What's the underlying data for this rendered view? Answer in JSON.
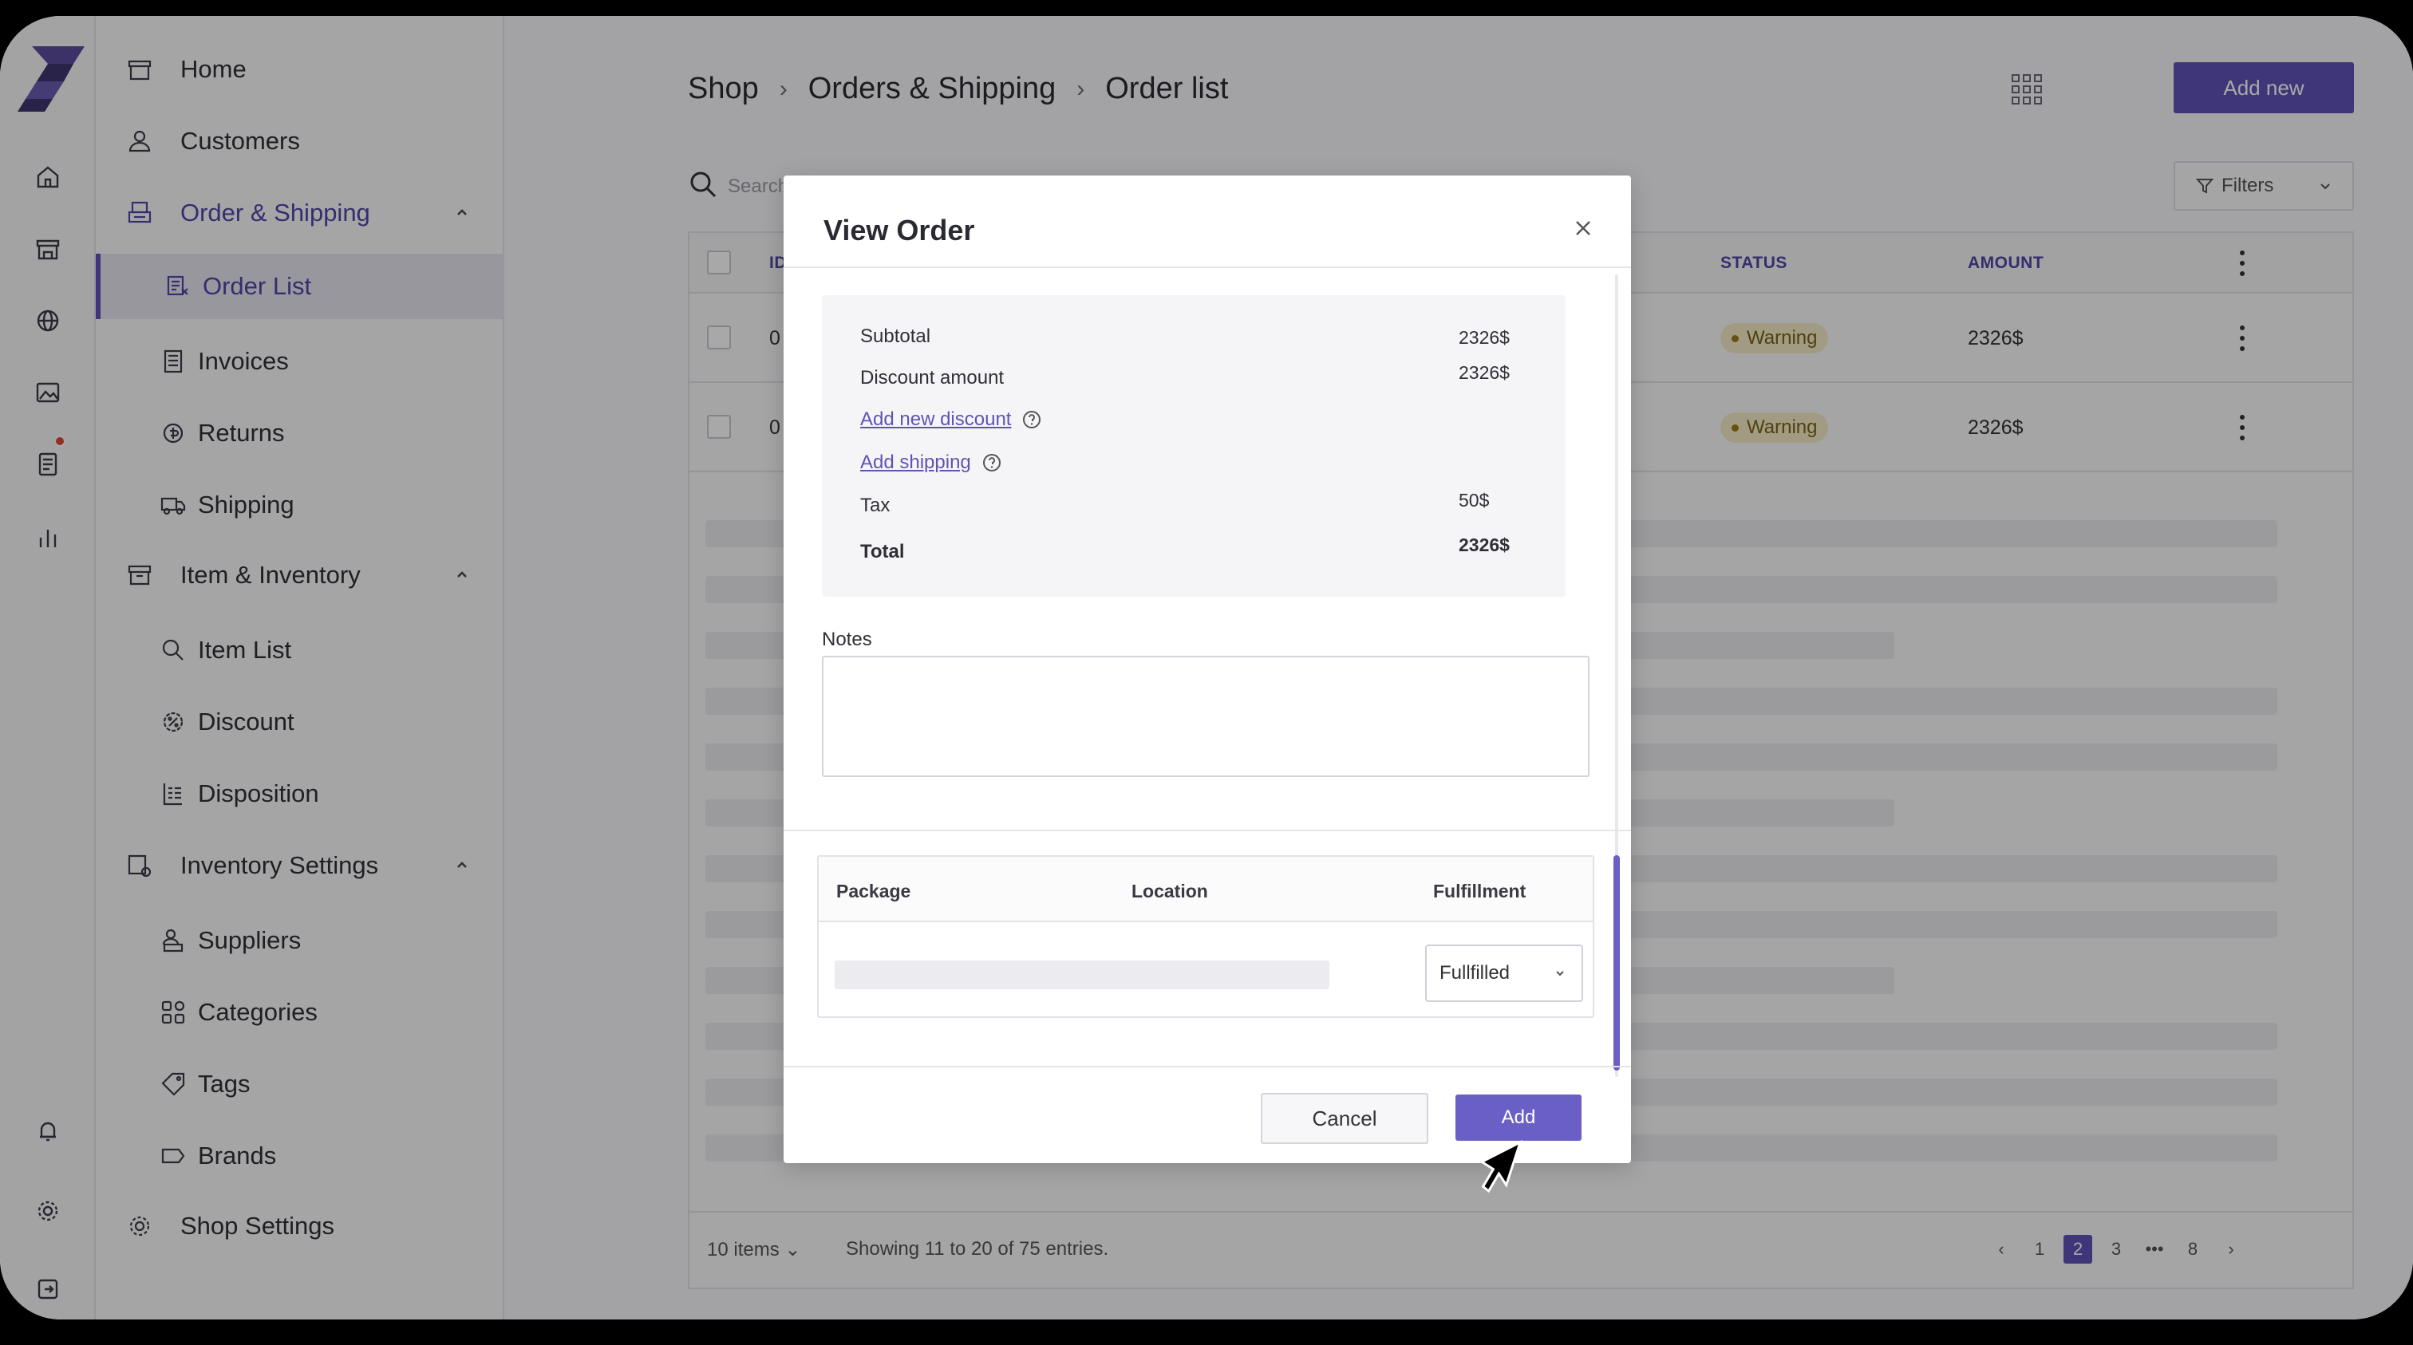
{
  "colors": {
    "accent": "#5f53b8",
    "warning_bg": "#f5ecc8",
    "warning_text": "#7b6218"
  },
  "rail": {
    "icons": [
      "logo-icon",
      "home-icon",
      "store-icon",
      "globe-icon",
      "image-icon",
      "document-icon",
      "chart-icon",
      "bell-icon",
      "gear-icon",
      "logout-icon"
    ]
  },
  "sidebar": {
    "items": [
      {
        "label": "Home",
        "icon": "store-icon"
      },
      {
        "label": "Customers",
        "icon": "person-icon"
      },
      {
        "label": "Order & Shipping",
        "icon": "printer-icon"
      },
      {
        "label": "Order List",
        "icon": "list-icon"
      },
      {
        "label": "Invoices",
        "icon": "invoice-icon"
      },
      {
        "label": "Returns",
        "icon": "return-icon"
      },
      {
        "label": "Shipping",
        "icon": "truck-icon"
      },
      {
        "label": "Item & Inventory",
        "icon": "archive-icon"
      },
      {
        "label": "Item List",
        "icon": "search-icon"
      },
      {
        "label": "Discount",
        "icon": "discount-icon"
      },
      {
        "label": "Disposition",
        "icon": "disposition-icon"
      },
      {
        "label": "Inventory Settings",
        "icon": "inventory-settings-icon"
      },
      {
        "label": "Suppliers",
        "icon": "suppliers-icon"
      },
      {
        "label": "Categories",
        "icon": "categories-icon"
      },
      {
        "label": "Tags",
        "icon": "tag-icon"
      },
      {
        "label": "Brands",
        "icon": "label-icon"
      },
      {
        "label": "Shop Settings",
        "icon": "gear-icon"
      }
    ]
  },
  "header": {
    "breadcrumb": [
      "Shop",
      "Orders & Shipping",
      "Order list"
    ],
    "add_new_label": "Add new"
  },
  "toolbar": {
    "search_placeholder": "Search",
    "filters_label": "Filters"
  },
  "table": {
    "columns": [
      "ID",
      "STATUS",
      "AMOUNT"
    ],
    "rows": [
      {
        "id": "0",
        "status": "Warning",
        "amount": "2326$"
      },
      {
        "id": "0",
        "status": "Warning",
        "amount": "2326$"
      }
    ],
    "footer": {
      "items_per_page": "10 items",
      "showing": "Showing 11 to 20 of 75 entries."
    },
    "pagination": {
      "pages": [
        "1",
        "2",
        "3",
        "•••",
        "8"
      ],
      "current": "2"
    }
  },
  "modal": {
    "title": "View Order",
    "summary": {
      "subtotal_label": "Subtotal",
      "subtotal_value": "2326$",
      "discount_label": "Discount amount",
      "discount_value": "2326$",
      "add_discount_link": "Add new discount",
      "add_shipping_link": "Add shipping",
      "tax_label": "Tax",
      "tax_value": "50$",
      "total_label": "Total",
      "total_value": "2326$"
    },
    "notes_label": "Notes",
    "notes_value": "",
    "package_table": {
      "columns": [
        "Package",
        "Location",
        "Fulfillment"
      ],
      "fulfillment_value": "Fullfilled"
    },
    "cancel_label": "Cancel",
    "add_label": "Add"
  }
}
